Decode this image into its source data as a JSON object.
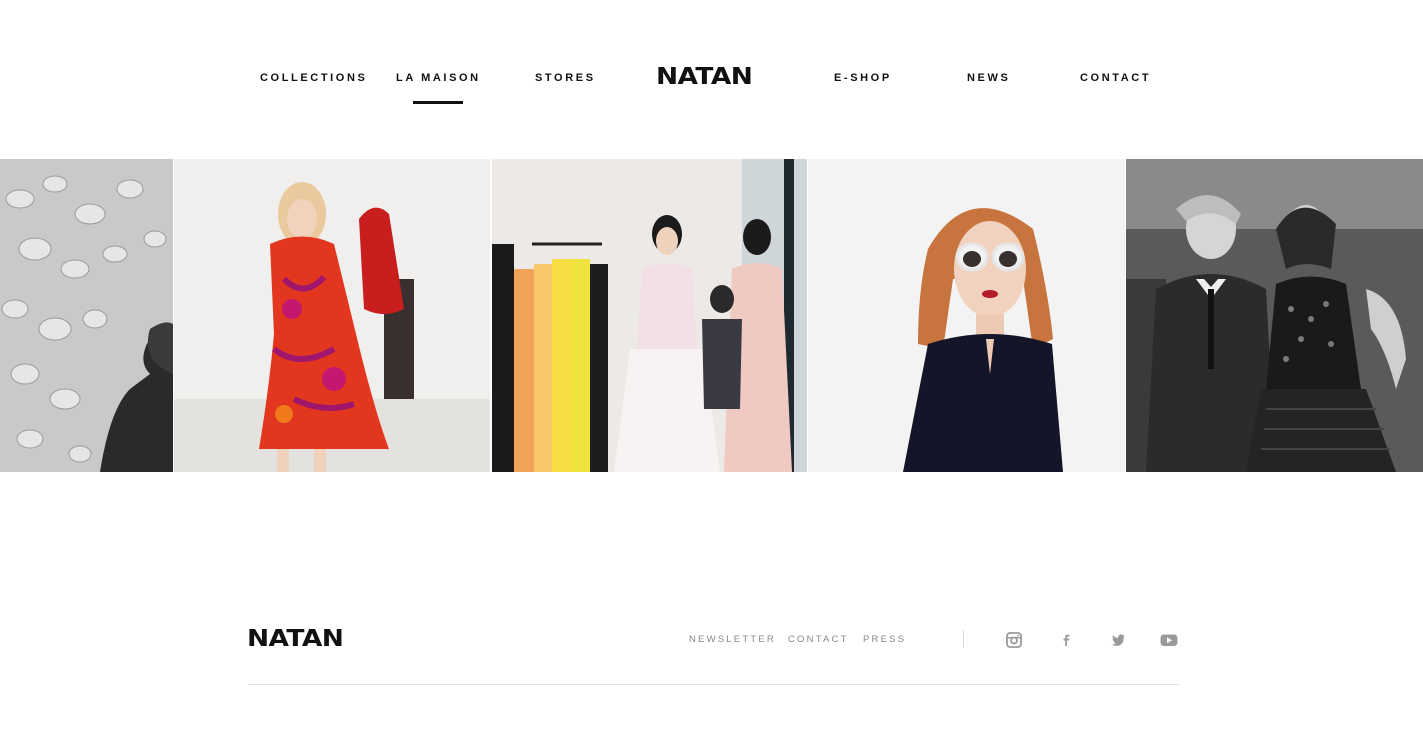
{
  "brand": {
    "logo_text": "NATAN"
  },
  "nav": {
    "items": [
      {
        "label": "COLLECTIONS"
      },
      {
        "label": "LA MAISON",
        "active": true
      },
      {
        "label": "STORES"
      },
      {
        "label": "E-SHOP"
      },
      {
        "label": "NEWS"
      },
      {
        "label": "CONTACT"
      }
    ]
  },
  "gallery": {
    "photos": [
      {
        "subject": "black and white installation with woman silhouette"
      },
      {
        "subject": "model in red floral dress on runway"
      },
      {
        "subject": "showroom with clothing rail and women in pastel dresses"
      },
      {
        "subject": "red-haired model in white sunglasses and navy dress"
      },
      {
        "subject": "black and white portrait of man in suit and woman in sequin dress"
      }
    ]
  },
  "footer": {
    "logo_text": "NATAN",
    "links": [
      {
        "label": "NEWSLETTER"
      },
      {
        "label": "CONTACT"
      },
      {
        "label": "PRESS"
      }
    ],
    "social": [
      {
        "icon": "instagram-icon"
      },
      {
        "icon": "facebook-icon"
      },
      {
        "icon": "twitter-icon"
      },
      {
        "icon": "youtube-icon"
      }
    ]
  },
  "colors": {
    "text": "#111111",
    "muted": "#888888",
    "rule": "#e2e2e2"
  }
}
